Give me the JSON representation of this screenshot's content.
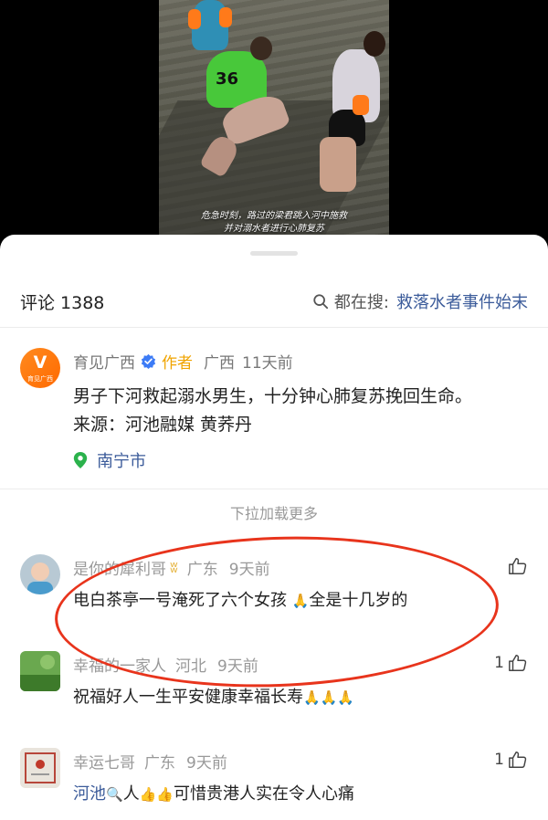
{
  "video": {
    "caption_line1": "危急时刻，路过的梁君跳入河中施救",
    "caption_line2": "并对溺水者进行心肺复苏",
    "shirt_number": "36"
  },
  "header": {
    "comment_count_label": "评论 1388",
    "search_prefix": "都在搜:",
    "search_topic": "救落水者事件始末"
  },
  "author_post": {
    "avatar_text": "V",
    "avatar_caption": "育见广西",
    "name": "育见广西",
    "tag": "作者",
    "region": "广西",
    "time": "11天前",
    "text": "男子下河救起溺水男生，十分钟心肺复苏挽回生命。\n来源：河池融媒 黄荞丹",
    "location": "南宁市"
  },
  "load_more": "下拉加载更多",
  "comments": [
    {
      "name": "是你的犀利哥",
      "badge": "ʬ",
      "region": "广东",
      "time": "9天前",
      "text_parts": [
        "电白茶亭一号淹死了六个女孩 ",
        "🙏",
        "全是十几岁的"
      ],
      "likes": ""
    },
    {
      "name": "幸福的一家人",
      "region": "河北",
      "time": "9天前",
      "text_parts": [
        "祝福好人一生平安健康幸福长寿",
        "🙏🙏🙏"
      ],
      "likes": "1"
    },
    {
      "name": "幸运七哥",
      "region": "广东",
      "time": "9天前",
      "text_parts": [
        "河池",
        "🔍",
        "人",
        "👍👍",
        "可惜贵港人实在令人心痛"
      ],
      "likes": "1"
    }
  ],
  "colors": {
    "accent_link": "#3b5b9a",
    "author_tag": "#f0a400",
    "annotation": "#e8341c",
    "brand_orange": "#ff7a10"
  }
}
